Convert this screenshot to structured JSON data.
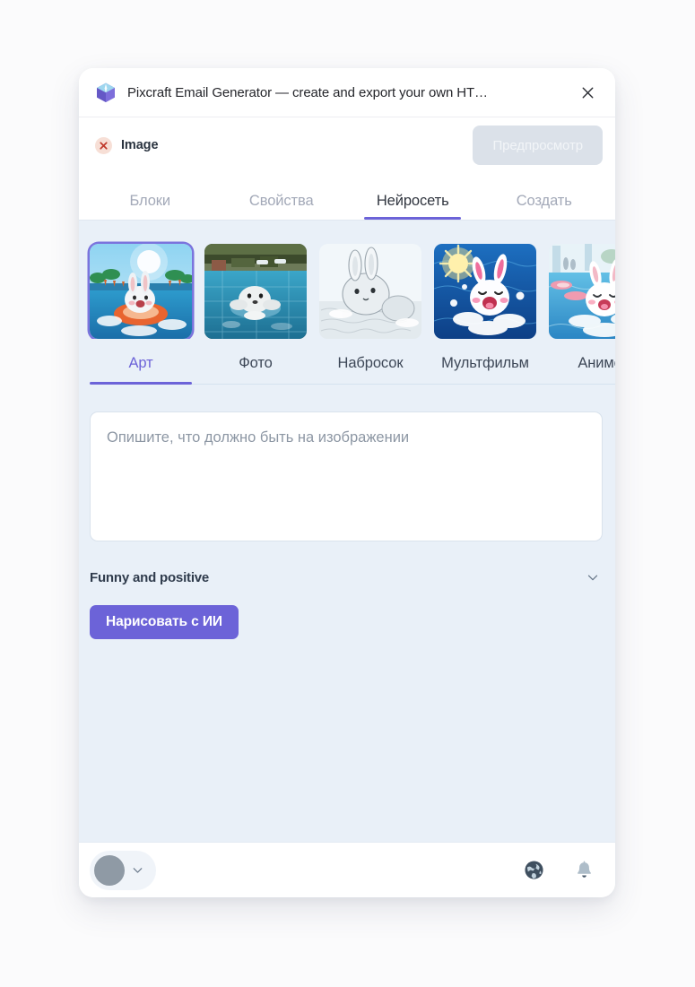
{
  "window": {
    "title": "Pixcraft Email Generator — create and export your own HT…",
    "logo_icon": "cube-logo-icon",
    "close_icon": "close-icon"
  },
  "subheader": {
    "object_icon": "x-circle-icon",
    "object_label": "Image",
    "preview_label": "Предпросмотр",
    "preview_disabled": true
  },
  "main_tabs": [
    {
      "label": "Блоки",
      "active": false
    },
    {
      "label": "Свойства",
      "active": false
    },
    {
      "label": "Нейросеть",
      "active": true
    },
    {
      "label": "Создать",
      "active": false
    }
  ],
  "styles": [
    {
      "label": "Арт",
      "active": true,
      "thumb": "rabbit-pool-art"
    },
    {
      "label": "Фото",
      "active": false,
      "thumb": "rabbit-pool-photo"
    },
    {
      "label": "Набросок",
      "active": false,
      "thumb": "rabbit-pool-sketch"
    },
    {
      "label": "Мультфильм",
      "active": false,
      "thumb": "rabbit-pool-cartoon"
    },
    {
      "label": "Аниме",
      "active": false,
      "thumb": "rabbit-pool-anime"
    }
  ],
  "prompt": {
    "value": "",
    "placeholder": "Опишите, что должно быть на изображении"
  },
  "mood": {
    "selected": "Funny and positive",
    "chevron_icon": "chevron-down-icon"
  },
  "generate": {
    "label": "Нарисовать с ИИ"
  },
  "footer": {
    "avatar_icon": "avatar",
    "account_chevron_icon": "chevron-down-icon",
    "globe_icon": "globe-icon",
    "bell_icon": "bell-icon"
  },
  "colors": {
    "accent": "#6c63d8",
    "panel_bg": "#e9f0f8",
    "page_bg": "#fbfbfc",
    "disabled_btn": "#dbe1e9",
    "x_badge": "#f7dfd6"
  }
}
